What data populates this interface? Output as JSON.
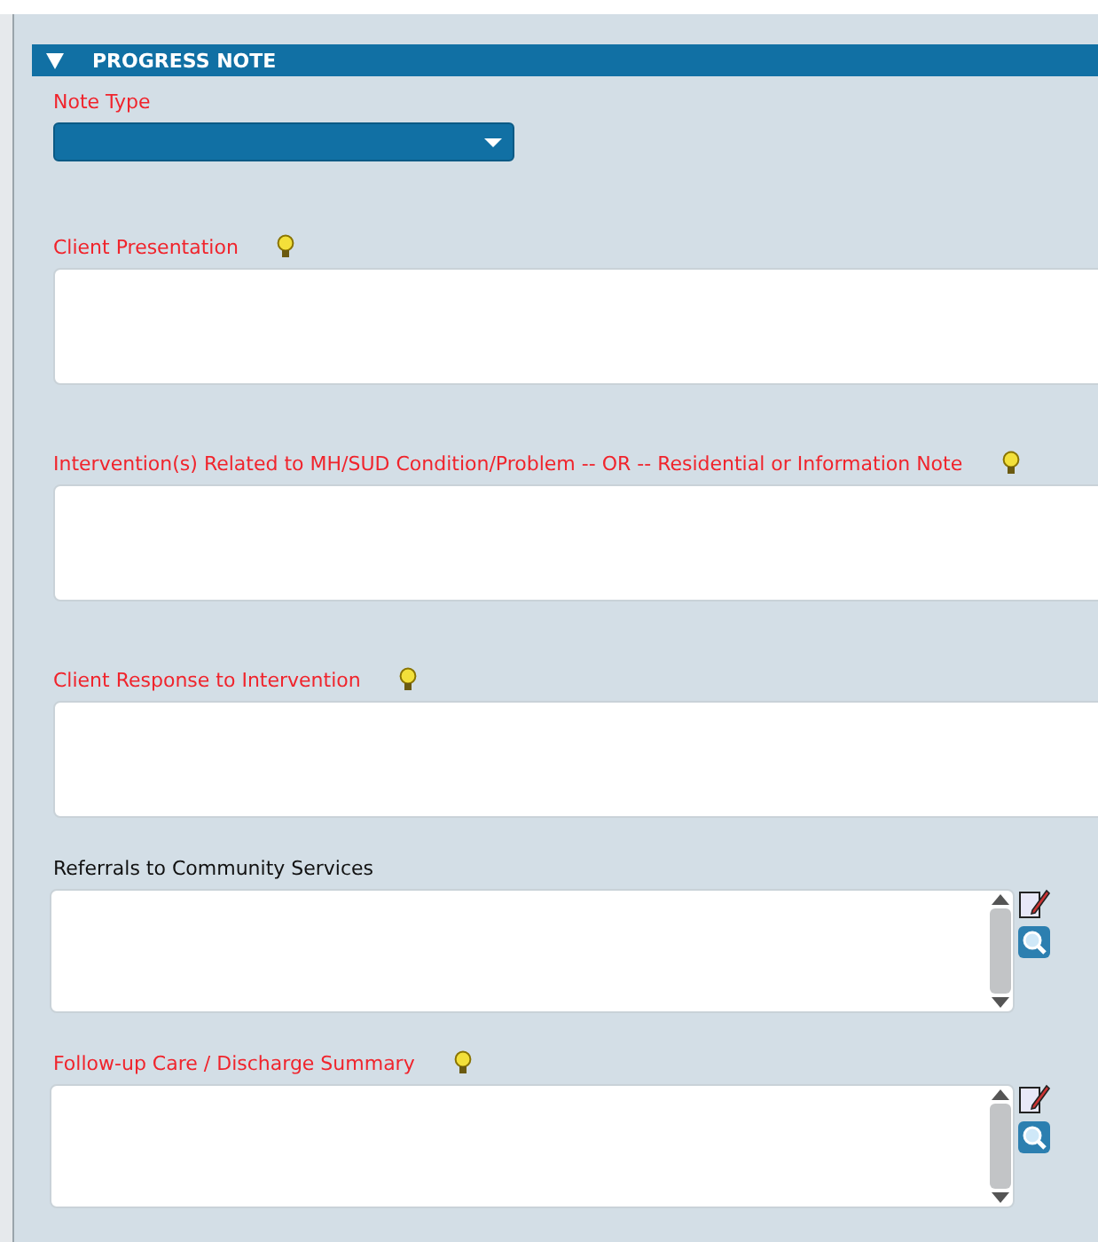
{
  "section": {
    "title": "PROGRESS NOTE",
    "expanded": true
  },
  "note_type": {
    "label": "Note Type",
    "required": true
  },
  "fields": [
    {
      "label": "Client Presentation",
      "required": true,
      "hint": true,
      "kind": "text"
    },
    {
      "label": "Intervention(s) Related to MH/SUD Condition/Problem -- OR -- Residential or Information Note",
      "required": true,
      "hint": true,
      "kind": "text"
    },
    {
      "label": "Client Response to Intervention",
      "required": true,
      "hint": true,
      "kind": "text"
    },
    {
      "label": "Referrals to Community Services",
      "required": false,
      "hint": false,
      "kind": "scroll"
    },
    {
      "label": "Follow-up Care / Discharge Summary",
      "required": true,
      "hint": true,
      "kind": "scroll"
    }
  ]
}
